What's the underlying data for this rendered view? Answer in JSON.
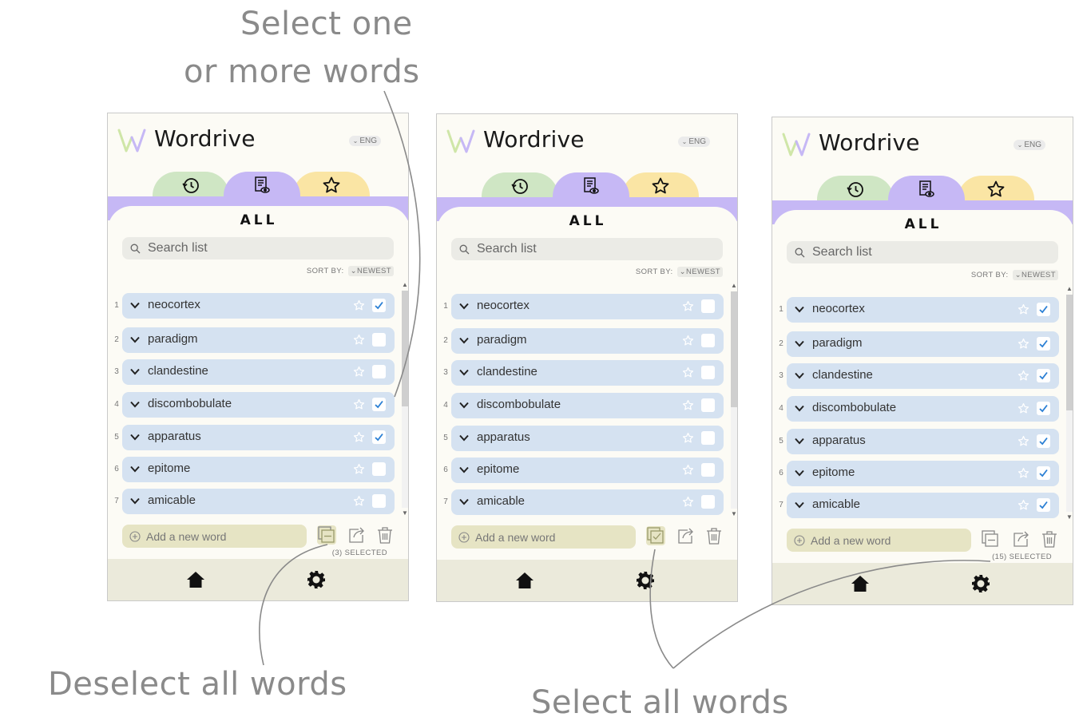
{
  "annotations": {
    "select_line1": "Select one",
    "select_line2": "or more words",
    "deselect": "Deselect all words",
    "select_all": "Select all words"
  },
  "colors": {
    "history_tab": "#cfe6c4",
    "list_tab": "#c6b8f5",
    "favorites_tab": "#fae5a4",
    "row": "#d5e2f1",
    "add_field": "#e6e4c4",
    "bottom_bar": "#ebeadb",
    "check": "#2a7fd4"
  },
  "screens": [
    {
      "brand": "Wordrive",
      "lang": "ENG",
      "tabs": [
        "history-icon",
        "list-view-icon",
        "star-icon"
      ],
      "title": "ALL",
      "search_placeholder": "Search list",
      "sort_label": "SORT BY:",
      "sort_value": "NEWEST",
      "words": [
        {
          "n": "1",
          "word": "neocortex",
          "checked": true
        },
        {
          "n": "2",
          "word": "paradigm",
          "checked": false
        },
        {
          "n": "3",
          "word": "clandestine",
          "checked": false
        },
        {
          "n": "4",
          "word": "discombobulate",
          "checked": true
        },
        {
          "n": "5",
          "word": "apparatus",
          "checked": true
        },
        {
          "n": "6",
          "word": "epitome",
          "checked": false
        },
        {
          "n": "7",
          "word": "amicable",
          "checked": false
        }
      ],
      "add_placeholder": "Add a new word",
      "select_toggle": "deselect-all-icon",
      "selected": "(3) SELECTED"
    },
    {
      "brand": "Wordrive",
      "lang": "ENG",
      "tabs": [
        "history-icon",
        "list-view-icon",
        "star-icon"
      ],
      "title": "ALL",
      "search_placeholder": "Search list",
      "sort_label": "SORT BY:",
      "sort_value": "NEWEST",
      "words": [
        {
          "n": "1",
          "word": "neocortex",
          "checked": false
        },
        {
          "n": "2",
          "word": "paradigm",
          "checked": false
        },
        {
          "n": "3",
          "word": "clandestine",
          "checked": false
        },
        {
          "n": "4",
          "word": "discombobulate",
          "checked": false
        },
        {
          "n": "5",
          "word": "apparatus",
          "checked": false
        },
        {
          "n": "6",
          "word": "epitome",
          "checked": false
        },
        {
          "n": "7",
          "word": "amicable",
          "checked": false
        }
      ],
      "add_placeholder": "Add a new word",
      "select_toggle": "select-all-icon",
      "selected": ""
    },
    {
      "brand": "Wordrive",
      "lang": "ENG",
      "tabs": [
        "history-icon",
        "list-view-icon",
        "star-icon"
      ],
      "title": "ALL",
      "search_placeholder": "Search list",
      "sort_label": "SORT BY:",
      "sort_value": "NEWEST",
      "words": [
        {
          "n": "1",
          "word": "neocortex",
          "checked": true
        },
        {
          "n": "2",
          "word": "paradigm",
          "checked": true
        },
        {
          "n": "3",
          "word": "clandestine",
          "checked": true
        },
        {
          "n": "4",
          "word": "discombobulate",
          "checked": true
        },
        {
          "n": "5",
          "word": "apparatus",
          "checked": true
        },
        {
          "n": "6",
          "word": "epitome",
          "checked": true
        },
        {
          "n": "7",
          "word": "amicable",
          "checked": true
        }
      ],
      "add_placeholder": "Add a new word",
      "select_toggle": "deselect-all-icon",
      "selected": "(15) SELECTED"
    }
  ]
}
